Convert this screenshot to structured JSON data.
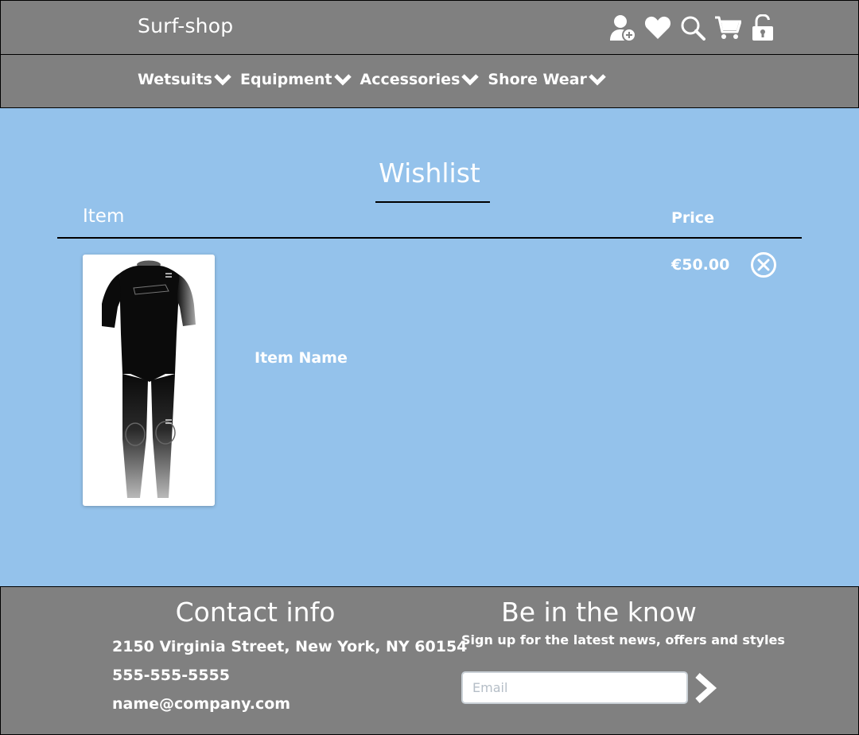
{
  "header": {
    "brand": "Surf-shop",
    "icons": [
      "user-add-icon",
      "heart-icon",
      "search-icon",
      "cart-icon",
      "lock-icon"
    ]
  },
  "nav": {
    "items": [
      {
        "label": "Wetsuits"
      },
      {
        "label": "Equipment"
      },
      {
        "label": "Accessories"
      },
      {
        "label": "Shore Wear"
      }
    ]
  },
  "wishlist": {
    "title": "Wishlist",
    "col_item": "Item",
    "col_price": "Price",
    "items": [
      {
        "name": "Item Name",
        "price": "€50.00"
      }
    ]
  },
  "footer": {
    "contact_title": "Contact info",
    "address": "2150 Virginia Street, New York, NY 60154",
    "phone": "555-555-5555",
    "email": "name@company.com",
    "newsletter_title": "Be in the know",
    "newsletter_sub": "Sign up for the latest news, offers and styles",
    "email_placeholder": "Email"
  },
  "colors": {
    "bar": "#808080",
    "page": "#94c2eb",
    "text": "#ffffff"
  }
}
